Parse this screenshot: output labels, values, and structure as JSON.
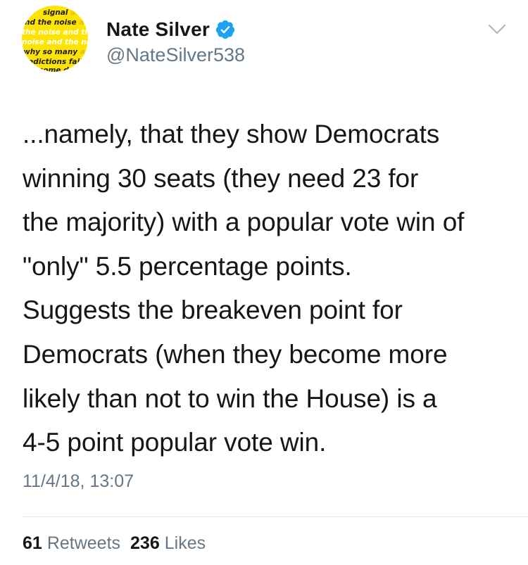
{
  "avatar": {
    "lines": [
      {
        "dark": "signal",
        "faint": " and"
      },
      {
        "dark": "nd the noise",
        "faint": " a"
      },
      {
        "dark": "the noise and th",
        "faint": "",
        "light_class": true
      },
      {
        "dark": "noise and the noi",
        "faint": "",
        "light_class": true
      },
      {
        "dark": "why so many",
        "faint": " anc"
      },
      {
        "dark": "redictions fail",
        "faint": "-"
      },
      {
        "dark": "some don'",
        "faint": ""
      }
    ]
  },
  "author": {
    "display_name": "Nate Silver",
    "handle": "@NateSilver538",
    "verified": true
  },
  "tweet": {
    "text": "...namely, that they show Democrats\nwinning 30 seats (they need 23 for\nthe majority) with a popular vote win of\n\"only\" 5.5 percentage points.\nSuggests the breakeven point for\nDemocrats (when they become more\nlikely than not to win the House) is a\n4-5 point popular vote win.",
    "timestamp": "11/4/18, 13:07"
  },
  "stats": {
    "retweets_count": "61",
    "retweets_label": "Retweets",
    "likes_count": "236",
    "likes_label": "Likes"
  },
  "colors": {
    "avatar_bg": "#ffe400",
    "verified_blue": "#1da1f2",
    "text_primary": "#14171a",
    "text_secondary": "#657786"
  },
  "icons": {
    "verified": "verified-badge-icon",
    "menu": "chevron-down-icon"
  }
}
